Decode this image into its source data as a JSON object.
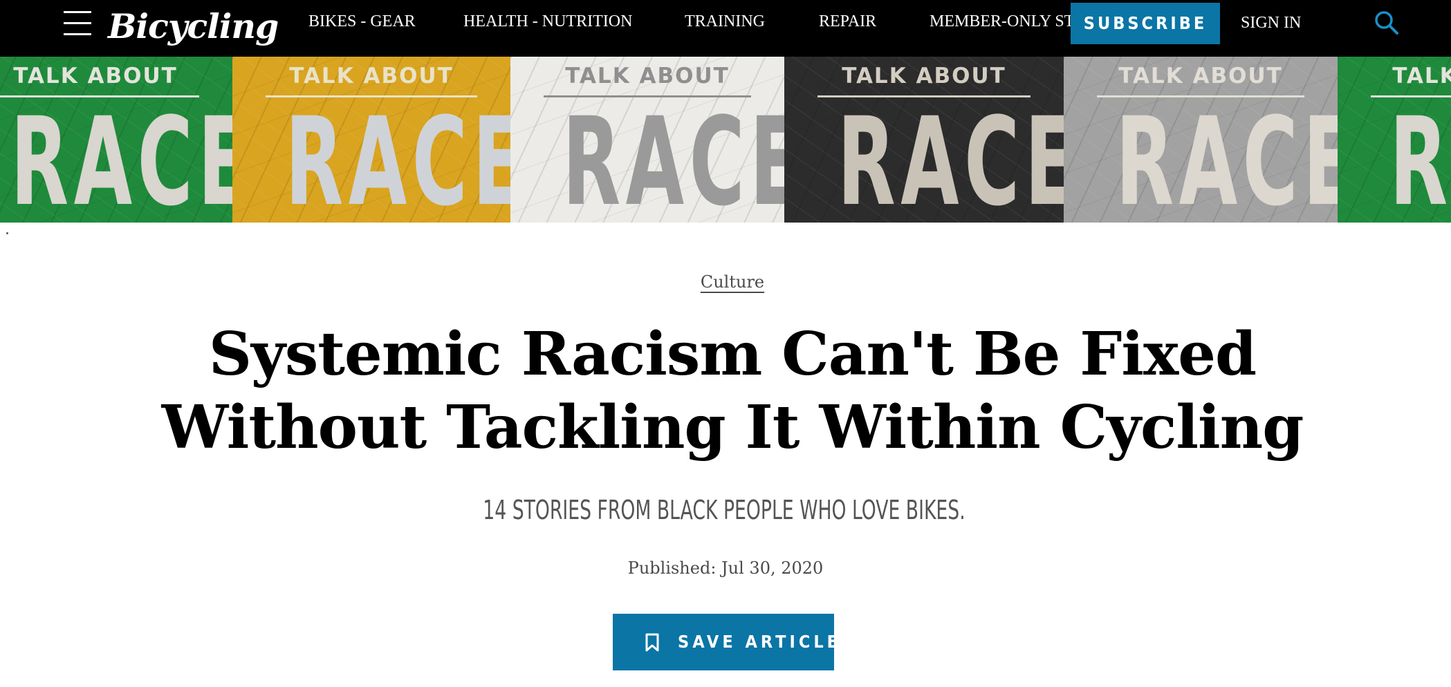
{
  "site": {
    "logo": "Bicycling"
  },
  "nav": {
    "items": [
      "BIKES - GEAR",
      "HEALTH - NUTRITION",
      "TRAINING",
      "REPAIR",
      "MEMBER-ONLY STORIES"
    ],
    "subscribe_label": "SUBSCRIBE",
    "signin_label": "SIGN IN"
  },
  "hero": {
    "tiles": [
      {
        "top": "TALK ABOUT",
        "big": "RACE",
        "bg": "#1f8a3b",
        "fg": "#d8d6cf",
        "topfg": "#e4e4dc"
      },
      {
        "top": "TALK ABOUT",
        "big": "RACE",
        "bg": "#d9a41f",
        "fg": "#cfd3d8",
        "topfg": "#e8e2c9"
      },
      {
        "top": "TALK ABOUT",
        "big": "RACE",
        "bg": "#ecebe8",
        "fg": "#9a9a9a",
        "topfg": "#8f8f8f"
      },
      {
        "top": "TALK ABOUT",
        "big": "RACE",
        "bg": "#2c2c2c",
        "fg": "#c9c3b7",
        "topfg": "#d3cdc2"
      },
      {
        "top": "TALK ABOUT",
        "big": "RACE",
        "bg": "#a2a2a2",
        "fg": "#ddd8cf",
        "topfg": "#e2ded6"
      },
      {
        "top": "TALK ABOUT",
        "big": "RACE",
        "bg": "#1f8a3b",
        "fg": "#d8d6cf",
        "topfg": "#e4e4dc"
      }
    ]
  },
  "article": {
    "category": "Culture",
    "headline_line1": "Systemic Racism Can't Be Fixed",
    "headline_line2": "Without Tackling It Within Cycling",
    "dek": "14 STORIES FROM BLACK PEOPLE WHO LOVE BIKES.",
    "published": "Published: Jul 30, 2020",
    "save_label": "SAVE ARTICLE"
  },
  "colors": {
    "accent": "#0b75a6",
    "nav_bg": "#000000"
  },
  "icons": {
    "menu": "hamburger-menu-icon",
    "search": "search-icon",
    "save": "bookmark-icon"
  }
}
